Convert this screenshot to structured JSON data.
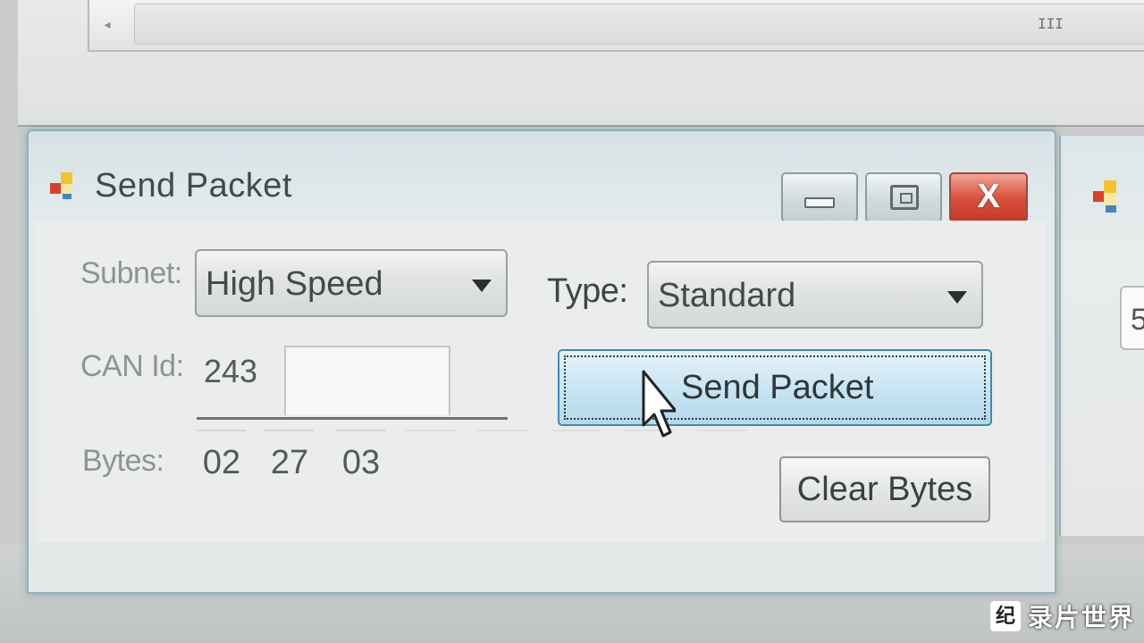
{
  "background_window": {
    "scroll_left_arrow": "◂",
    "thumb_grip": "III"
  },
  "right_window": {
    "field_value": "5"
  },
  "dialog": {
    "title": "Send Packet",
    "close_glyph": "X",
    "subnet_label": "Subnet:",
    "subnet_value": "High Speed",
    "type_label": "Type:",
    "type_value": "Standard",
    "can_id_label": "CAN Id:",
    "can_id_value": "243",
    "send_button": "Send Packet",
    "bytes_label": "Bytes:",
    "bytes": [
      "02",
      "27",
      "03",
      "",
      "",
      "",
      "",
      ""
    ],
    "clear_button": "Clear Bytes"
  },
  "watermark": {
    "logo": "纪",
    "text": "录片世界"
  },
  "colors": {
    "dialog_border": "#8fb2ba",
    "send_button_border": "#3e8ab3",
    "close_button": "#d8533f"
  }
}
